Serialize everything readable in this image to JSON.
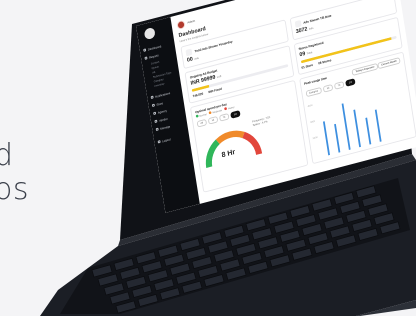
{
  "background_text": {
    "line1": "d",
    "line2": "os"
  },
  "sidebar": {
    "items": [
      {
        "label": "Dashboard"
      },
      {
        "label": "Reports"
      },
      {
        "label": "Content",
        "sub": true
      },
      {
        "label": "Queue",
        "sub": true
      },
      {
        "label": "Ad",
        "sub": true
      },
      {
        "label": "Submission Type",
        "sub": true
      },
      {
        "label": "Category",
        "sub": true
      },
      {
        "label": "Inventory",
        "sub": true
      },
      {
        "label": "Notifications"
      },
      {
        "label": "Store"
      },
      {
        "label": "Agency"
      },
      {
        "label": "Vendor"
      },
      {
        "label": "Manage"
      },
      {
        "label": "Logout"
      }
    ]
  },
  "header": {
    "admin": "Admin",
    "title": "Dashboard",
    "subtitle": "Here's the insights below"
  },
  "cards": {
    "ads_shown_yesterday": {
      "title": "Total Ads Shown Yesterday",
      "value": "00",
      "unit": "Ads"
    },
    "ads_shown_to_date": {
      "title": "Ads Shown Till Date",
      "value": "3072",
      "unit": "Ads"
    },
    "ongoing_budget": {
      "title": "Ongoing Ad Budget",
      "value": "INR 99999",
      "unit": "Left",
      "progress": 0.18,
      "left_value": "746.020",
      "right_value": "INR Fixed"
    },
    "stores_registered": {
      "title": "Stores Registered",
      "value": "09",
      "unit": "Total",
      "progress": 0.95,
      "left_value": "01 Store",
      "right_value": "08 Stores"
    }
  },
  "optimal_spend": {
    "title": "Optimal spend per day",
    "legend": [
      "Normal",
      "Moderate",
      "Heavy"
    ],
    "buttons": [
      "All",
      "1d",
      "7d",
      "1m"
    ],
    "active_button": "1m",
    "gauge_value": "8 Hr",
    "frequency_label": "Frequency : 7/21",
    "spike_label": "Spikes : 4.2%"
  },
  "peak_usage": {
    "title": "Peak usage time",
    "filters": [
      "Today's Exposure",
      "Current Month"
    ],
    "buttons": [
      "Category",
      "1d",
      "7d",
      "1m"
    ],
    "active_button": "1m",
    "y_labels": [
      "4000",
      "3000",
      "2000"
    ]
  },
  "colors": {
    "accent": "#f2c31a",
    "blue": "#3d8fe0",
    "sidebar": "#0c0e12",
    "gauge_green": "#2fb65a",
    "gauge_orange": "#f08a2a",
    "gauge_red": "#e2463b"
  }
}
